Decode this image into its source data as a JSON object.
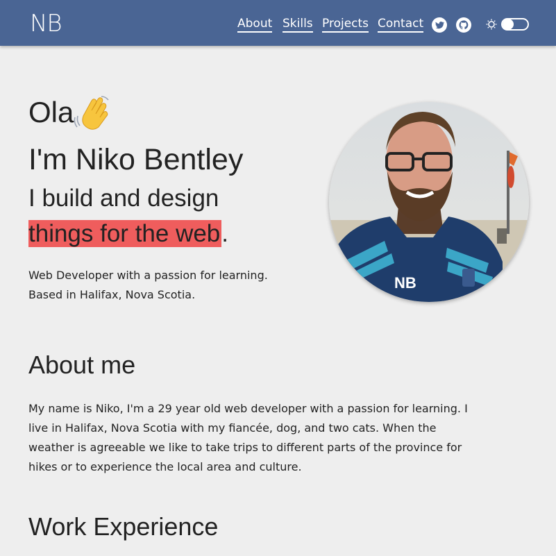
{
  "header": {
    "logo": "NB",
    "nav": [
      "About",
      "Skills",
      "Projects",
      "Contact"
    ],
    "icons": [
      "twitter-icon",
      "github-icon",
      "sun-icon"
    ],
    "background": "#4a6594"
  },
  "hero": {
    "greeting": "Ola",
    "greeting_emoji": "wave-icon",
    "name": "I'm Niko Bentley",
    "tagline_line1": "I build and design",
    "tagline_highlight": "things for the web",
    "tagline_end": ".",
    "intro_line1": "Web Developer with a passion for learning.",
    "intro_line2": "Based in Halifax, Nova Scotia.",
    "highlight_color": "#ef5d5d"
  },
  "about": {
    "title": "About me",
    "text": "My name is Niko, I'm a 29 year old web developer with a passion for learning. I live in Halifax, Nova Scotia with my fiancée, dog, and two cats. When the weather is agreeable we like to take trips to different parts of the province for hikes or to experience the local area and culture."
  },
  "work": {
    "title": "Work Experience"
  }
}
